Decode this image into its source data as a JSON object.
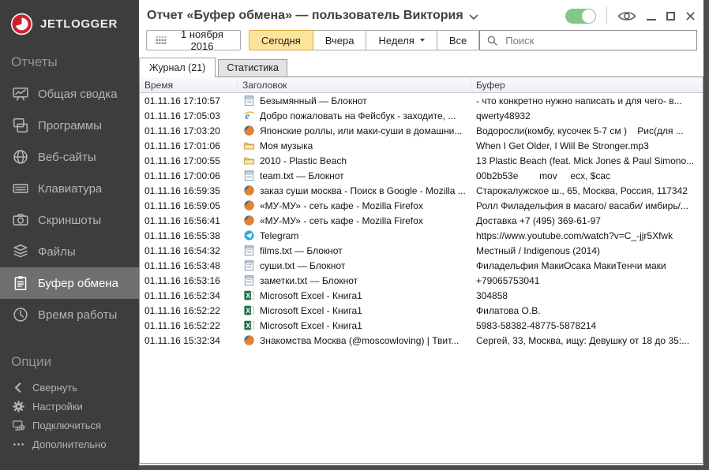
{
  "sidebar": {
    "logo_text": "JETLOGGER",
    "sections": [
      {
        "header": "Отчеты",
        "items": [
          {
            "key": "summary",
            "icon": "dashboard-icon",
            "label": "Общая сводка"
          },
          {
            "key": "programs",
            "icon": "programs-icon",
            "label": "Программы"
          },
          {
            "key": "websites",
            "icon": "globe-icon",
            "label": "Веб-сайты"
          },
          {
            "key": "keyboard",
            "icon": "keyboard-icon",
            "label": "Клавиатура"
          },
          {
            "key": "screenshots",
            "icon": "camera-icon",
            "label": "Скриншоты"
          },
          {
            "key": "files",
            "icon": "layers-icon",
            "label": "Файлы"
          },
          {
            "key": "clipboard",
            "icon": "clipboard-icon",
            "label": "Буфер обмена",
            "selected": true
          },
          {
            "key": "worktime",
            "icon": "clock-icon",
            "label": "Время работы"
          }
        ]
      },
      {
        "header": "Опции",
        "small": true,
        "items": [
          {
            "key": "collapse",
            "icon": "chevron-left-icon",
            "label": "Свернуть"
          },
          {
            "key": "settings",
            "icon": "gear-icon",
            "label": "Настройки"
          },
          {
            "key": "connect",
            "icon": "connect-icon",
            "label": "Подключиться"
          },
          {
            "key": "more",
            "icon": "ellipsis-icon",
            "label": "Дополнительно"
          }
        ]
      }
    ]
  },
  "header": {
    "title": "Отчет «Буфер обмена» — пользователь Виктория",
    "toggle_on": true
  },
  "toolbar": {
    "date_label": "1 ноября 2016",
    "filters": [
      {
        "key": "today",
        "label": "Сегодня",
        "active": true
      },
      {
        "key": "yesterday",
        "label": "Вчера"
      },
      {
        "key": "week",
        "label": "Неделя",
        "dropdown": true
      },
      {
        "key": "all",
        "label": "Все"
      }
    ],
    "search_placeholder": "Поиск"
  },
  "tabs": [
    {
      "key": "journal",
      "label": "Журнал (21)",
      "active": true
    },
    {
      "key": "stats",
      "label": "Статистика"
    }
  ],
  "table": {
    "columns": [
      "Время",
      "Заголовок",
      "Буфер"
    ],
    "rows": [
      {
        "time": "01.11.16 17:10:57",
        "icon": "notepad-icon",
        "title": "Безымянный — Блокнот",
        "buffer": "- что конкретно нужно написать и для чего- в..."
      },
      {
        "time": "01.11.16 17:05:03",
        "icon": "internet-explorer-icon",
        "title": "Добро пожаловать на Фейсбук - заходите, ...",
        "buffer": "qwerty48932"
      },
      {
        "time": "01.11.16 17:03:20",
        "icon": "firefox-icon",
        "title": "Японские роллы, или маки-суши в домашни...",
        "buffer": "Водоросли(комбу, кусочек 5-7 см )    Рис(для ..."
      },
      {
        "time": "01.11.16 17:01:06",
        "icon": "folder-icon",
        "title": "Моя музыка",
        "buffer": "When I Get Older, I Will Be Stronger.mp3"
      },
      {
        "time": "01.11.16 17:00:55",
        "icon": "folder-icon",
        "title": "2010 - Plastic Beach",
        "buffer": "13 Plastic Beach (feat. Mick Jones & Paul Simono..."
      },
      {
        "time": "01.11.16 17:00:06",
        "icon": "notepad-icon",
        "title": "team.txt — Блокнот",
        "buffer": "00b2b53e        mov     ecx, $cac"
      },
      {
        "time": "01.11.16 16:59:35",
        "icon": "firefox-icon",
        "title": "заказ суши москва - Поиск в Google - Mozilla ...",
        "buffer": "Старокалужское ш., 65, Москва, Россия, 117342"
      },
      {
        "time": "01.11.16 16:59:05",
        "icon": "firefox-icon",
        "title": "«МУ-МУ» - сеть кафе - Mozilla Firefox",
        "buffer": "Ролл Филадельфия в масаго/ васаби/ имбирь/..."
      },
      {
        "time": "01.11.16 16:56:41",
        "icon": "firefox-icon",
        "title": "«МУ-МУ» - сеть кафе - Mozilla Firefox",
        "buffer": "Доставка +7 (495) 369-61-97"
      },
      {
        "time": "01.11.16 16:55:38",
        "icon": "telegram-icon",
        "title": "Telegram",
        "buffer": "https://www.youtube.com/watch?v=C_-jjr5Xfwk"
      },
      {
        "time": "01.11.16 16:54:32",
        "icon": "notepad-icon",
        "title": "films.txt — Блокнот",
        "buffer": "Местный / Indigenous (2014)"
      },
      {
        "time": "01.11.16 16:53:48",
        "icon": "notepad-icon",
        "title": "суши.txt — Блокнот",
        "buffer": "Филадельфия МакиОсака МакиТенчи маки"
      },
      {
        "time": "01.11.16 16:53:16",
        "icon": "notepad-icon",
        "title": "заметки.txt — Блокнот",
        "buffer": "+79065753041"
      },
      {
        "time": "01.11.16 16:52:34",
        "icon": "excel-icon",
        "title": "Microsoft Excel - Книга1",
        "buffer": "304858"
      },
      {
        "time": "01.11.16 16:52:22",
        "icon": "excel-icon",
        "title": "Microsoft Excel - Книга1",
        "buffer": "Филатова О.В."
      },
      {
        "time": "01.11.16 16:52:22",
        "icon": "excel-icon",
        "title": "Microsoft Excel - Книга1",
        "buffer": "5983-58382-48775-5878214"
      },
      {
        "time": "01.11.16 15:32:34",
        "icon": "firefox-icon",
        "title": "Знакомства Москва (@moscowloving) | Твит...",
        "buffer": "Сергей, 33, Москва, ищу: Девушку от 18 до 35:..."
      }
    ]
  },
  "colors": {
    "accent_red": "#cf2030",
    "toggle_green": "#82c785",
    "active_filter_bg": "#fce49b",
    "active_filter_border": "#dcab4c",
    "sidebar_bg": "#3d3d3d",
    "selected_item_bg": "#6f6f6f"
  }
}
